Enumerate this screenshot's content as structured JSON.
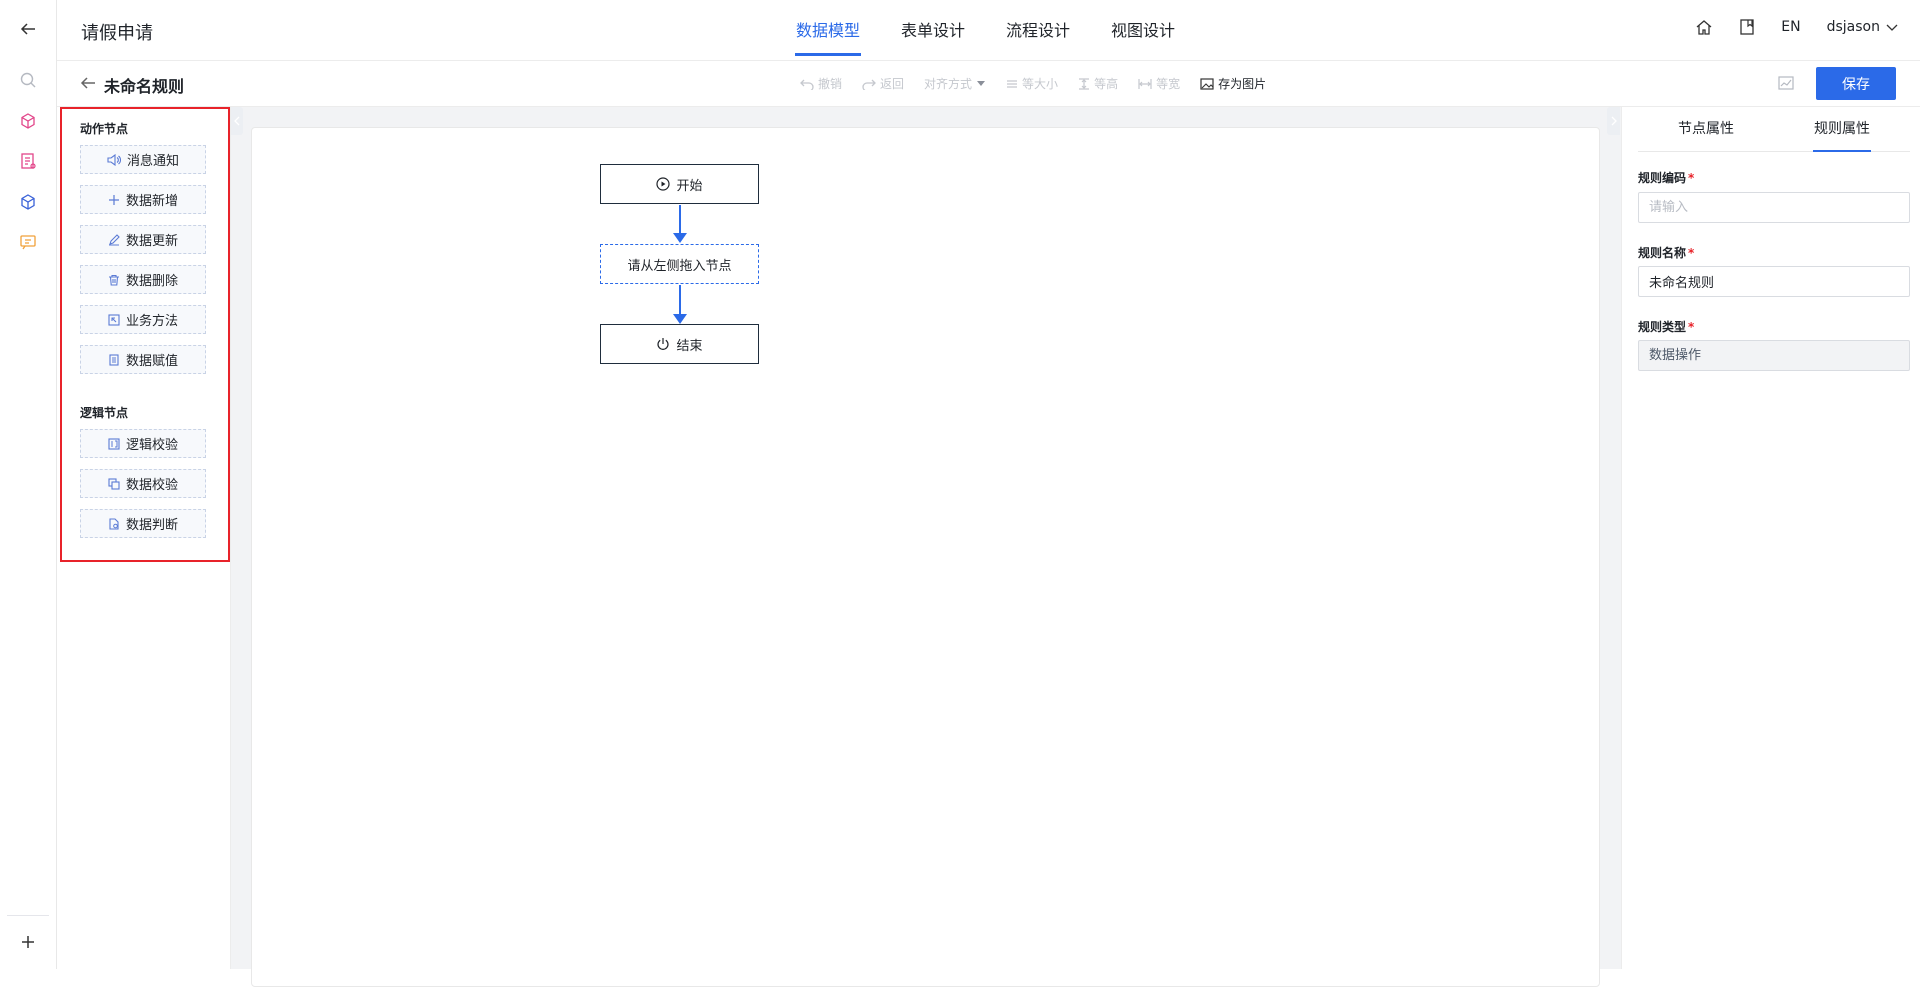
{
  "header": {
    "app_title": "请假申请",
    "tabs": [
      {
        "label": "数据模型",
        "active": true
      },
      {
        "label": "表单设计",
        "active": false
      },
      {
        "label": "流程设计",
        "active": false
      },
      {
        "label": "视图设计",
        "active": false
      }
    ],
    "lang": "EN",
    "username": "dsjason"
  },
  "subbar": {
    "title": "未命名规则",
    "toolbar": {
      "undo": "撤销",
      "redo": "返回",
      "align": "对齐方式",
      "same_size": "等大小",
      "same_height": "等高",
      "same_width": "等宽",
      "save_image": "存为图片"
    },
    "save_label": "保存"
  },
  "palette": {
    "action_heading": "动作节点",
    "action_items": [
      "消息通知",
      "数据新增",
      "数据更新",
      "数据删除",
      "业务方法",
      "数据赋值"
    ],
    "logic_heading": "逻辑节点",
    "logic_items": [
      "逻辑校验",
      "数据校验",
      "数据判断"
    ]
  },
  "flow": {
    "start": "开始",
    "placeholder": "请从左侧拖入节点",
    "end": "结束"
  },
  "right_panel": {
    "tabs": [
      "节点属性",
      "规则属性"
    ],
    "active_tab": 1,
    "rule_code_label": "规则编码",
    "rule_code_placeholder": "请输入",
    "rule_name_label": "规则名称",
    "rule_name_value": "未命名规则",
    "rule_type_label": "规则类型",
    "rule_type_value": "数据操作"
  },
  "colors": {
    "accent": "#2b6ae8",
    "highlight_frame": "#e8232a"
  }
}
